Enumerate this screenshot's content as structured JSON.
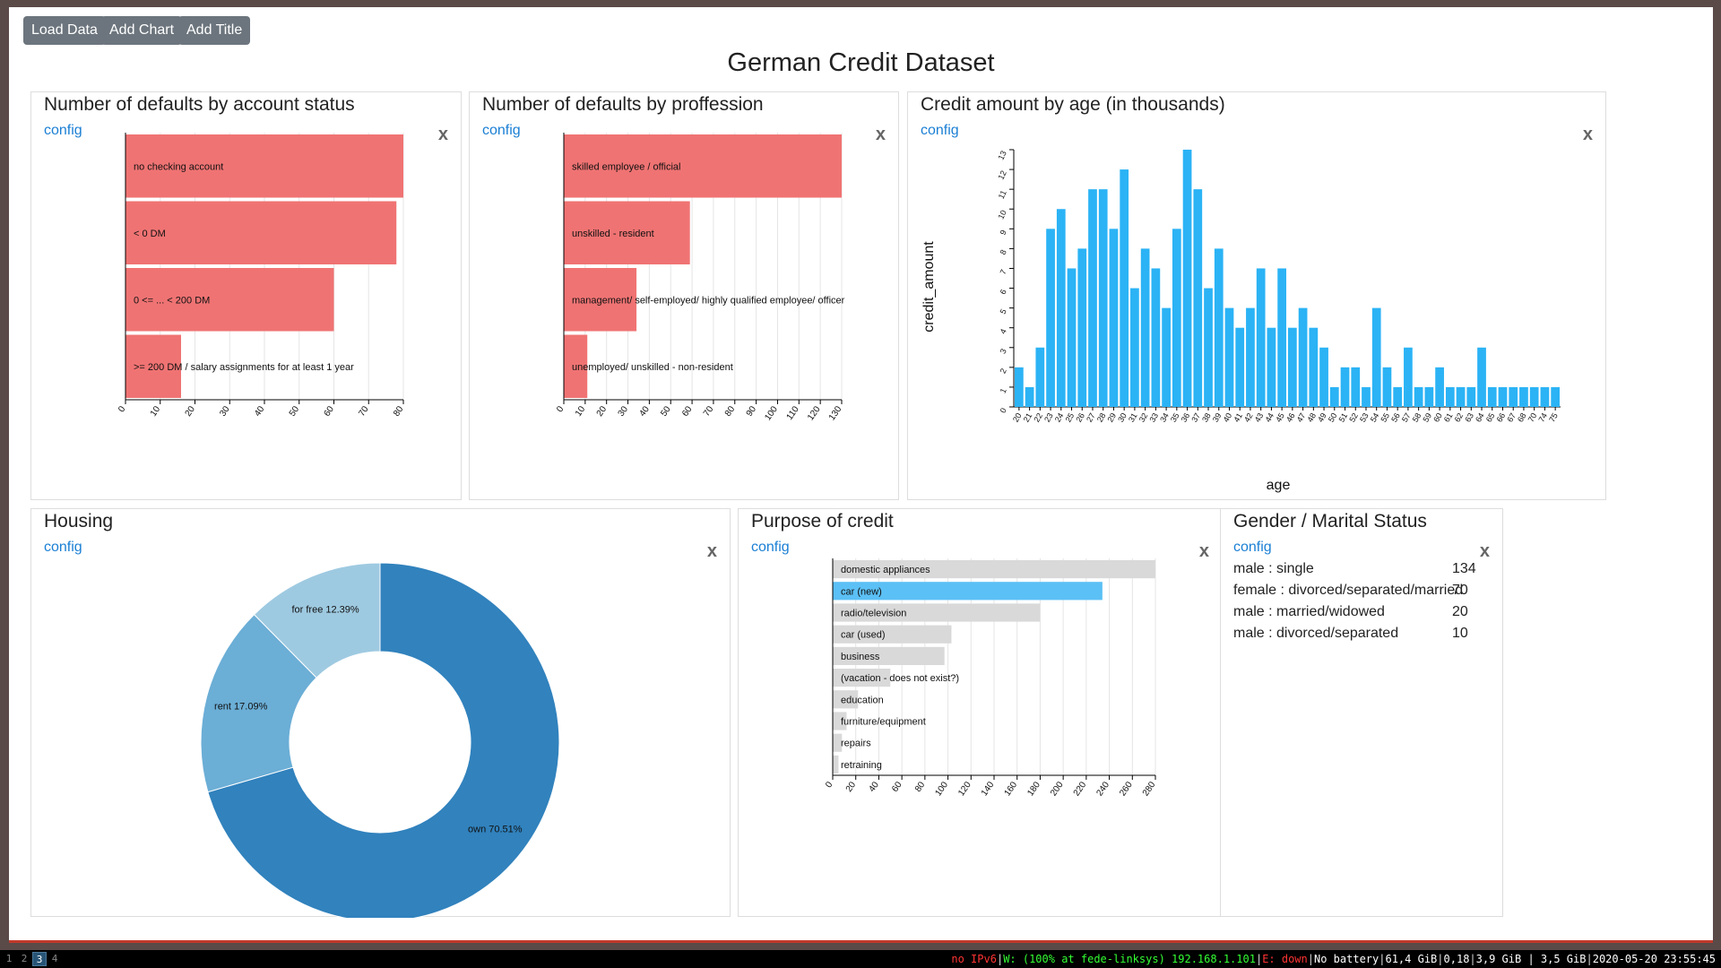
{
  "toolbar": {
    "load_label": "Load Data",
    "chart_label": "Add Chart",
    "title_label": "Add Title"
  },
  "page_title": "German Credit Dataset",
  "config_label": "config",
  "close_label": "x",
  "colors": {
    "red_bar": "#f07373",
    "blue_bar": "#2bb3f5",
    "grey_bar": "#d9d9d9",
    "highlight_bar": "#5bc0f5",
    "pie_own": "#3182bd",
    "pie_rent": "#6baed6",
    "pie_free": "#9ecae1"
  },
  "panels": {
    "account": {
      "title": "Number of defaults by account status",
      "chart_data": {
        "type": "bar",
        "orientation": "horizontal",
        "categories": [
          "no checking account",
          "< 0 DM",
          "0 <= ... < 200 DM",
          ">= 200 DM / salary assignments for at least 1 year"
        ],
        "values": [
          80,
          78,
          60,
          16
        ],
        "xlim": [
          0,
          80
        ],
        "ticks": [
          0,
          10,
          20,
          30,
          40,
          50,
          60,
          70,
          80
        ]
      }
    },
    "profession": {
      "title": "Number of defaults by proffession",
      "chart_data": {
        "type": "bar",
        "orientation": "horizontal",
        "categories": [
          "skilled employee / official",
          "unskilled - resident",
          "management/ self-employed/ highly qualified employee/ officer",
          "unemployed/ unskilled - non-resident"
        ],
        "values": [
          130,
          59,
          34,
          11
        ],
        "xlim": [
          0,
          130
        ],
        "ticks": [
          0,
          10,
          20,
          30,
          40,
          50,
          60,
          70,
          80,
          90,
          100,
          110,
          120,
          130
        ]
      }
    },
    "credit_age": {
      "title": "Credit amount by age (in thousands)",
      "chart_data": {
        "type": "bar",
        "xlabel": "age",
        "ylabel": "credit_amount",
        "ylim": [
          0,
          13
        ],
        "yticks": [
          0,
          1,
          2,
          3,
          4,
          5,
          6,
          7,
          8,
          9,
          10,
          11,
          12,
          13
        ],
        "categories": [
          "20",
          "21",
          "22",
          "23",
          "24",
          "25",
          "26",
          "27",
          "28",
          "29",
          "30",
          "31",
          "32",
          "33",
          "34",
          "35",
          "36",
          "37",
          "38",
          "39",
          "40",
          "41",
          "42",
          "43",
          "44",
          "45",
          "46",
          "47",
          "48",
          "49",
          "50",
          "51",
          "52",
          "53",
          "54",
          "55",
          "56",
          "57",
          "58",
          "59",
          "60",
          "61",
          "62",
          "63",
          "64",
          "65",
          "66",
          "67",
          "68",
          "70",
          "74",
          "75"
        ],
        "values": [
          2,
          1,
          3,
          9,
          10,
          7,
          8,
          11,
          11,
          9,
          12,
          6,
          8,
          7,
          5,
          9,
          13,
          11,
          6,
          8,
          5,
          4,
          5,
          7,
          4,
          7,
          4,
          5,
          4,
          3,
          1,
          2,
          2,
          1,
          5,
          2,
          1,
          3,
          1,
          1,
          2,
          1,
          1,
          1,
          3,
          1,
          1,
          1,
          1,
          1,
          1,
          1
        ]
      }
    },
    "housing": {
      "title": "Housing",
      "chart_data": {
        "type": "pie",
        "donut": true,
        "slices": [
          {
            "label": "own 70.51%",
            "value": 70.51
          },
          {
            "label": "rent 17.09%",
            "value": 17.09
          },
          {
            "label": "for free 12.39%",
            "value": 12.39
          }
        ]
      }
    },
    "purpose": {
      "title": "Purpose of credit",
      "chart_data": {
        "type": "bar",
        "orientation": "horizontal",
        "categories": [
          "domestic appliances",
          "car (new)",
          "radio/television",
          "car (used)",
          "business",
          "(vacation - does not exist?)",
          "education",
          "furniture/equipment",
          "repairs",
          "retraining"
        ],
        "values": [
          280,
          234,
          180,
          103,
          97,
          50,
          22,
          12,
          8,
          5
        ],
        "highlighted": "car (new)",
        "xlim": [
          0,
          280
        ],
        "ticks": [
          0,
          20,
          40,
          60,
          80,
          100,
          120,
          140,
          160,
          180,
          200,
          220,
          240,
          260,
          280
        ]
      }
    },
    "gender": {
      "title": "Gender / Marital Status",
      "rows": [
        {
          "label": "male : single",
          "value": "134"
        },
        {
          "label": "female : divorced/separated/married",
          "value": "70"
        },
        {
          "label": "male : married/widowed",
          "value": "20"
        },
        {
          "label": "male : divorced/separated",
          "value": "10"
        }
      ]
    }
  },
  "statusbar": {
    "workspaces": [
      "1",
      "2",
      "3",
      "4"
    ],
    "active_workspace": "3",
    "ipv6": "no IPv6",
    "wifi": "W: (100% at fede-linksys) 192.168.1.101",
    "eth": "E: down",
    "battery": "No battery",
    "disk": "61,4 GiB",
    "load": "0,18",
    "mem": "3,9 GiB | 3,5 GiB",
    "datetime": "2020-05-20 23:55:45"
  }
}
